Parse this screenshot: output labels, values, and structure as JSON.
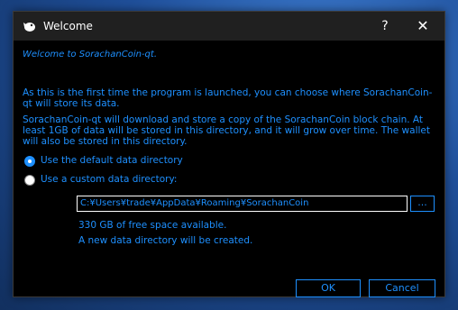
{
  "window": {
    "title": "Welcome",
    "help_glyph": "?",
    "close_glyph": "✕"
  },
  "intro": {
    "welcome": "Welcome to SorachanCoin-qt.",
    "para1": "As this is the first time the program is launched, you can choose where SorachanCoin-qt will store its data.",
    "para2": "SorachanCoin-qt will download and store a copy of the SorachanCoin block chain. At least 1GB of data will be stored in this directory, and it will grow over time. The wallet will also be stored in this directory."
  },
  "options": {
    "default_label": "Use the default data directory",
    "custom_label": "Use a custom data directory:",
    "selected": "default"
  },
  "directory": {
    "path": "C:¥Users¥trade¥AppData¥Roaming¥SorachanCoin",
    "browse_label": "..."
  },
  "status": {
    "free_space": "330 GB of free space available.",
    "new_dir": "A new data directory will be created."
  },
  "buttons": {
    "ok": "OK",
    "cancel": "Cancel"
  },
  "colors": {
    "accent": "#1e90ff",
    "background": "#000000",
    "titlebar": "#202020"
  },
  "icons": {
    "app": "coin-app-icon",
    "help": "help-icon",
    "close": "close-icon"
  }
}
